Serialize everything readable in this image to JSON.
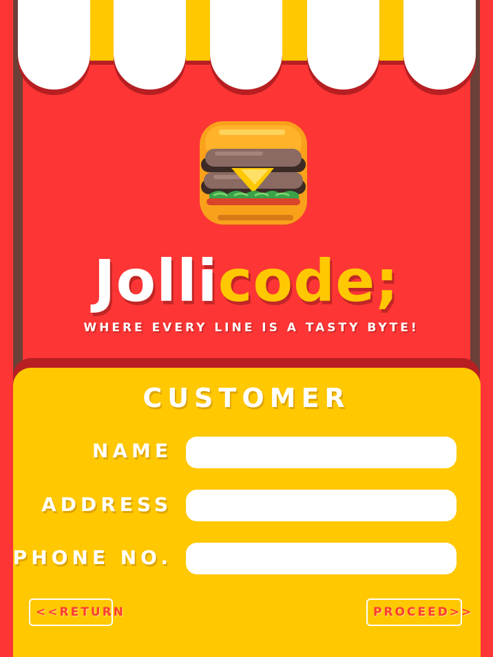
{
  "brand": {
    "name_part1": "Jolli",
    "name_part2": "code;",
    "tagline": "WHERE EVERY LINE IS A TASTY BYTE!",
    "logo_icon": "burger-icon"
  },
  "customer_form": {
    "title": "CUSTOMER",
    "fields": [
      {
        "label": "NAME",
        "value": "",
        "placeholder": ""
      },
      {
        "label": "ADDRESS",
        "value": "",
        "placeholder": ""
      },
      {
        "label": "PHONE NO.",
        "value": "",
        "placeholder": ""
      }
    ],
    "return_label": "<<RETURN",
    "proceed_label": "PROCEED>>"
  },
  "colors": {
    "background_red": "#fd3535",
    "accent_yellow": "#ffc800",
    "white": "#ffffff",
    "button_text": "#ff3b2f"
  }
}
